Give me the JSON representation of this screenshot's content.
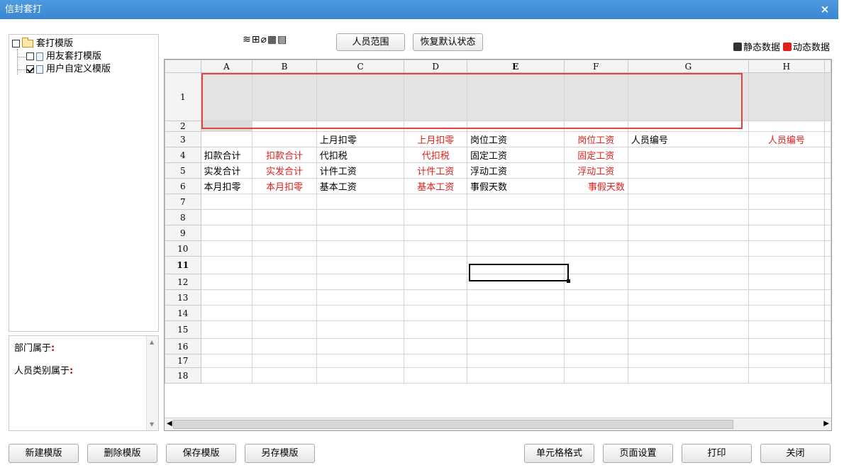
{
  "window": {
    "title": "信封套打",
    "close_glyph": "×"
  },
  "tree": {
    "root": {
      "label": "套打模版",
      "checked": false
    },
    "children": [
      {
        "label": "用友套打模版",
        "checked": false
      },
      {
        "label": "用户自定义模版",
        "checked": true
      }
    ]
  },
  "info": {
    "dept_label": "部门属于",
    "category_label": "人员类别属于",
    "colon": ":"
  },
  "toolbar": {
    "icons": [
      "format-icon",
      "table-icon",
      "eraser-icon",
      "print-layout-icon",
      "print-setup-icon"
    ],
    "icon_glyphs": "≋⊞⌀▦▤",
    "person_range": "人员范围",
    "restore_default": "恢复默认状态"
  },
  "legend": {
    "static_label": "静态数据",
    "dynamic_label": "动态数据",
    "static_color": "#333333",
    "dynamic_color": "#e0201c"
  },
  "sheet": {
    "columns": [
      "A",
      "B",
      "C",
      "D",
      "E",
      "F",
      "G",
      "H"
    ],
    "active_column": "E",
    "active_row": "11",
    "rows": [
      {
        "n": "1",
        "cells": [
          "",
          "",
          "",
          "",
          "",
          "",
          "",
          ""
        ]
      },
      {
        "n": "2",
        "cells": [
          "",
          "",
          "",
          "",
          "",
          "",
          "",
          ""
        ]
      },
      {
        "n": "3",
        "cells": [
          "",
          "",
          "上月扣零",
          "上月扣零",
          "岗位工资",
          "岗位工资",
          "人员编号",
          "人员编号"
        ]
      },
      {
        "n": "4",
        "cells": [
          "扣款合计",
          "扣款合计",
          "代扣税",
          "代扣税",
          "固定工资",
          "固定工资",
          "",
          ""
        ]
      },
      {
        "n": "5",
        "cells": [
          "实发合计",
          "实发合计",
          "计件工资",
          "计件工资",
          "浮动工资",
          "浮动工资",
          "",
          ""
        ]
      },
      {
        "n": "6",
        "cells": [
          "本月扣零",
          "本月扣零",
          "基本工资",
          "基本工资",
          "事假天数",
          "事假天数",
          "",
          ""
        ]
      },
      {
        "n": "7",
        "cells": [
          "",
          "",
          "",
          "",
          "",
          "",
          "",
          ""
        ]
      },
      {
        "n": "8",
        "cells": [
          "",
          "",
          "",
          "",
          "",
          "",
          "",
          ""
        ]
      },
      {
        "n": "9",
        "cells": [
          "",
          "",
          "",
          "",
          "",
          "",
          "",
          ""
        ]
      },
      {
        "n": "10",
        "cells": [
          "",
          "",
          "",
          "",
          "",
          "",
          "",
          ""
        ]
      },
      {
        "n": "11",
        "cells": [
          "",
          "",
          "",
          "",
          "",
          "",
          "",
          ""
        ]
      },
      {
        "n": "12",
        "cells": [
          "",
          "",
          "",
          "",
          "",
          "",
          "",
          ""
        ]
      },
      {
        "n": "13",
        "cells": [
          "",
          "",
          "",
          "",
          "",
          "",
          "",
          ""
        ]
      },
      {
        "n": "14",
        "cells": [
          "",
          "",
          "",
          "",
          "",
          "",
          "",
          ""
        ]
      },
      {
        "n": "15",
        "cells": [
          "",
          "",
          "",
          "",
          "",
          "",
          "",
          ""
        ]
      },
      {
        "n": "16",
        "cells": [
          "",
          "",
          "",
          "",
          "",
          "",
          "",
          ""
        ]
      },
      {
        "n": "17",
        "cells": [
          "",
          "",
          "",
          "",
          "",
          "",
          "",
          ""
        ]
      },
      {
        "n": "18",
        "cells": [
          "",
          "",
          "",
          "",
          "",
          "",
          "",
          ""
        ]
      }
    ],
    "dynamic_columns": [
      "B",
      "D",
      "F",
      "H"
    ]
  },
  "buttons": {
    "new_template": "新建模版",
    "delete_template": "删除模版",
    "save_template": "保存模版",
    "save_as_template": "另存模版",
    "cell_format": "单元格格式",
    "page_setup": "页面设置",
    "print": "打印",
    "close": "关闭"
  }
}
